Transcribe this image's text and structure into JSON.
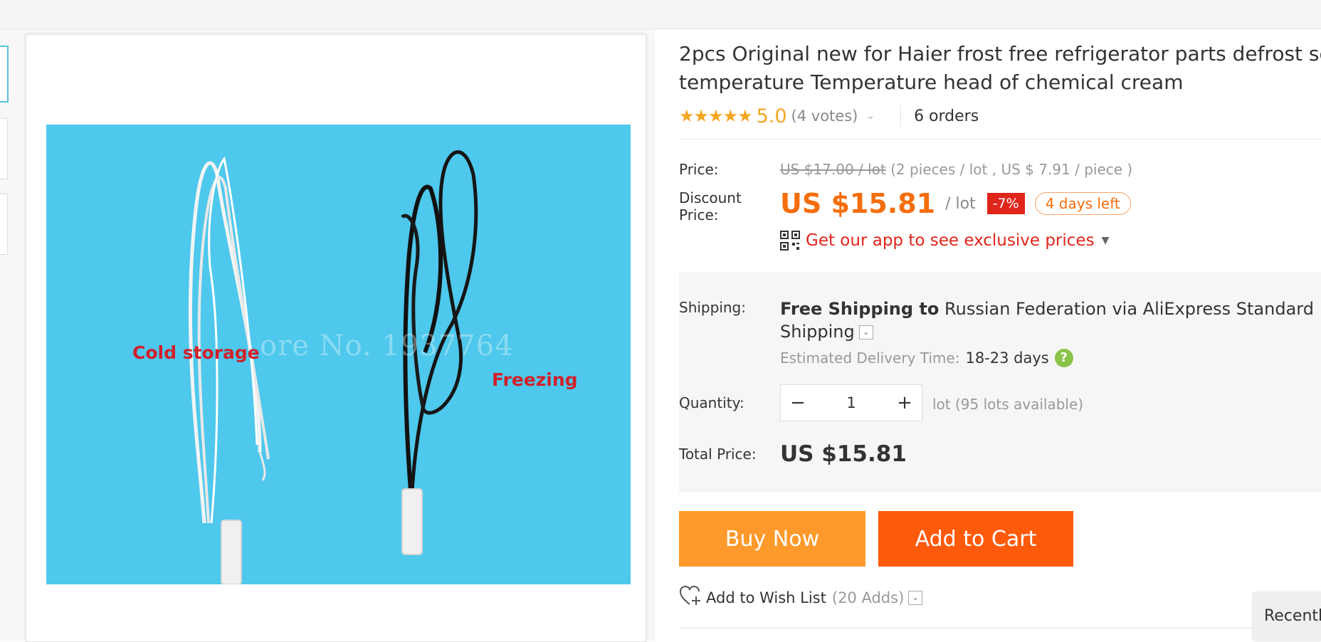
{
  "product": {
    "title_line1": "2pcs Original new for Haier frost free refrigerator parts defrost sensor",
    "title_line2": "temperature Temperature head of chemical cream",
    "rating": {
      "stars": "★★★★★",
      "score": "5.0",
      "votes": "(4 votes)",
      "orders": "6 orders"
    }
  },
  "image": {
    "label_cold": "Cold storage",
    "label_freeze": "Freezing",
    "watermark": "ore No. 1937764"
  },
  "pricing": {
    "price_label": "Price:",
    "original_price": "US $17.00 / lot",
    "original_price_detail": " (2 pieces / lot , US $ 7.91 / piece )",
    "discount_label_line1": "Discount",
    "discount_label_line2": "Price:",
    "discount_price": "US $15.81",
    "unit": "/ lot",
    "discount_percent": "-7%",
    "days_left": "4 days left",
    "app_promo": "Get our app to see exclusive prices"
  },
  "shipping": {
    "label": "Shipping:",
    "free_shipping": "Free Shipping to",
    "destination": " Russian Federation via AliExpress Standard Shipping",
    "estimated_label": "Estimated Delivery Time:",
    "estimated_days": "18-23 days"
  },
  "quantity": {
    "label": "Quantity:",
    "minus": "−",
    "value": "1",
    "plus": "+",
    "available": "lot (95 lots available)"
  },
  "total": {
    "label": "Total Price:",
    "value": "US $15.81"
  },
  "actions": {
    "buy_now": "Buy Now",
    "add_to_cart": "Add to Cart",
    "wish_list": "Add to Wish List",
    "wish_adds": "(20 Adds)"
  },
  "recent": {
    "label": "Recently Viewed"
  },
  "colors": {
    "accent_orange": "#f46e0c",
    "buy_now": "#fd9a2b",
    "add_to_cart": "#fe5a0c",
    "discount_red": "#e0251b",
    "star": "#f5a623",
    "photo_bg": "#4ec8ec"
  }
}
